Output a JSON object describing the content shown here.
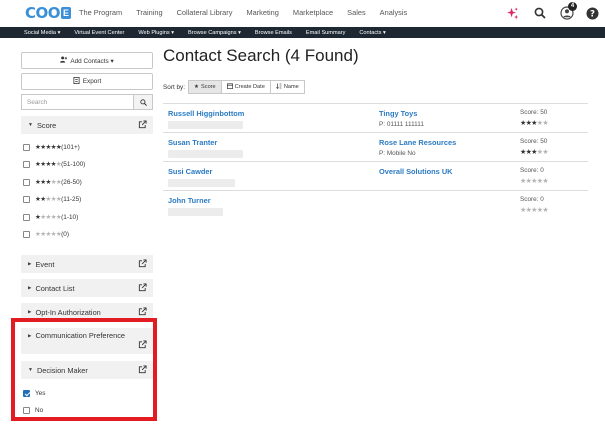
{
  "brand": {
    "logo_text": "COO",
    "logo_badge": "E"
  },
  "main_nav": [
    "The Program",
    "Training",
    "Collateral Library",
    "Marketing",
    "Marketplace",
    "Sales",
    "Analysis"
  ],
  "notifications": {
    "count": "4"
  },
  "sub_nav": [
    "Social Media ▾",
    "Virtual Event Center",
    "Web Plugins ▾",
    "Browse Campaigns ▾",
    "Browse Emails",
    "Email Summary",
    "Contacts ▾"
  ],
  "sidebar": {
    "add_contacts": "Add Contacts ▾",
    "export": "Export",
    "search_placeholder": "Search",
    "score_header": "Score",
    "score_options": [
      {
        "on": "★★★★★",
        "off": "",
        "label": "(101+)"
      },
      {
        "on": "★★★★",
        "off": "★",
        "label": "(51-100)"
      },
      {
        "on": "★★★",
        "off": "★★",
        "label": "(26-50)"
      },
      {
        "on": "★★",
        "off": "★★★",
        "label": "(11-25)"
      },
      {
        "on": "★",
        "off": "★★★★",
        "label": "(1-10)"
      },
      {
        "on": "",
        "off": "★★★★★",
        "label": "(0)"
      }
    ],
    "filters": {
      "event": "Event",
      "contact_list": "Contact List",
      "opt_in": "Opt-In Authorization",
      "communication": "Communication Preference",
      "decision_maker": "Decision Maker"
    },
    "decision_options": [
      {
        "label": "Yes",
        "checked": true
      },
      {
        "label": "No",
        "checked": false
      }
    ]
  },
  "main": {
    "title": "Contact Search  (4 Found)",
    "sort_label": "Sort by:",
    "sort_options": [
      "Score",
      "Create Date",
      "Name"
    ],
    "contacts": [
      {
        "name": "Russell Higginbottom",
        "company": "Tingy Toys",
        "phone": "P: 01111 111111",
        "score": "Score: 50",
        "stars_on": "★★★",
        "stars_off": "★★"
      },
      {
        "name": "Susan Tranter",
        "company": "Rose Lane Resources",
        "phone": "P: Mobile No",
        "score": "Score: 50",
        "stars_on": "★★★",
        "stars_off": "★★"
      },
      {
        "name": "Susi Cawder",
        "company": "Overall Solutions UK",
        "phone": "",
        "score": "Score: 0",
        "stars_on": "",
        "stars_off": "★★★★★"
      },
      {
        "name": "John Turner",
        "company": "",
        "phone": "",
        "score": "Score: 0",
        "stars_on": "",
        "stars_off": "★★★★★"
      }
    ]
  },
  "colors": {
    "accent": "#2b7bc2",
    "subnav_bg": "#1e2833",
    "highlight_border": "#e31b23"
  }
}
